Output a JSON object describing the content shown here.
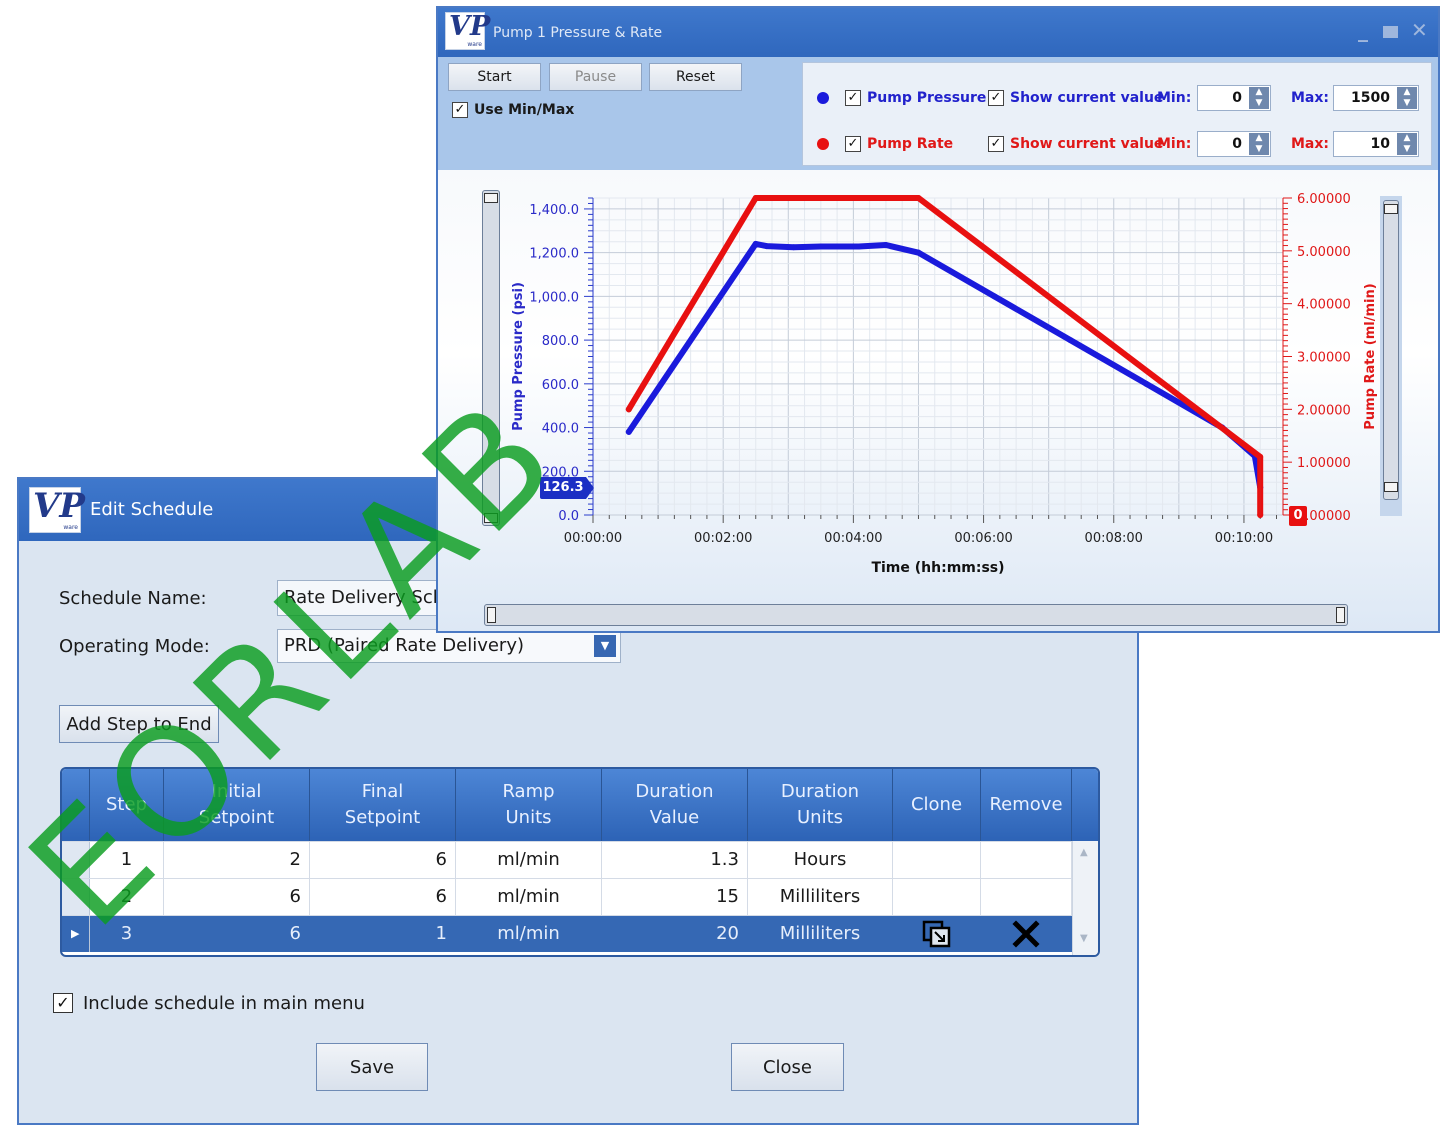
{
  "edit_schedule": {
    "title": "Edit Schedule",
    "logo_letters": "VP",
    "logo_sub": "ware",
    "schedule_name_label": "Schedule Name:",
    "schedule_name_value": "Rate Delivery Schedule",
    "operating_mode_label": "Operating Mode:",
    "operating_mode_value": "PRD (Paired Rate Delivery)",
    "add_step_label": "Add Step to End",
    "columns": [
      "Step",
      "Initial Setpoint",
      "Final Setpoint",
      "Ramp Units",
      "Duration Value",
      "Duration Units",
      "Clone",
      "Remove"
    ],
    "rows": [
      {
        "step": "1",
        "initial": "2",
        "final": "6",
        "ramp_units": "ml/min",
        "duration_value": "1.3",
        "duration_units": "Hours"
      },
      {
        "step": "2",
        "initial": "6",
        "final": "6",
        "ramp_units": "ml/min",
        "duration_value": "15",
        "duration_units": "Milliliters"
      },
      {
        "step": "3",
        "initial": "6",
        "final": "1",
        "ramp_units": "ml/min",
        "duration_value": "20",
        "duration_units": "Milliliters"
      }
    ],
    "selected_row": 3,
    "include_label": "Include schedule in main menu",
    "include_checked": true,
    "save_label": "Save",
    "close_label": "Close"
  },
  "pump_window": {
    "title": "Pump 1 Pressure & Rate",
    "logo_letters": "VP",
    "logo_sub": "ware",
    "start_label": "Start",
    "pause_label": "Pause",
    "reset_label": "Reset",
    "use_minmax_label": "Use Min/Max",
    "pressure_series_label": "Pump Pressure",
    "rate_series_label": "Pump Rate",
    "show_current_label": "Show current value",
    "min_label": "Min:",
    "max_label": "Max:",
    "pressure_min": "0",
    "pressure_max": "1500",
    "rate_min": "0",
    "rate_max": "10",
    "current_pressure": "126.3",
    "current_rate": "0",
    "colors": {
      "pressure": "#1a1adc",
      "rate": "#e81010"
    }
  },
  "watermark": "EORLAB",
  "chart_data": {
    "type": "line",
    "xlabel": "Time (hh:mm:ss)",
    "ylabel": "Pump Pressure (psi)",
    "y2label": "Pump Rate (ml/min)",
    "x_ticks": [
      "00:00:00",
      "00:02:00",
      "00:04:00",
      "00:06:00",
      "00:08:00",
      "00:10:00"
    ],
    "y_ticks": [
      "0.0",
      "200.0",
      "400.0",
      "600.0",
      "800.0",
      "1,000.0",
      "1,200.0",
      "1,400.0"
    ],
    "y2_ticks": [
      "0.00000",
      "1.00000",
      "2.00000",
      "3.00000",
      "4.00000",
      "5.00000",
      "6.00000"
    ],
    "xlim_seconds": [
      0,
      636
    ],
    "ylim": [
      0,
      1450
    ],
    "y2lim": [
      0,
      6.0
    ],
    "grid": true,
    "series": [
      {
        "name": "Pump Pressure",
        "axis": "left",
        "color": "#1a1adc",
        "x": [
          33,
          150,
          160,
          185,
          210,
          245,
          270,
          300,
          370,
          440,
          510,
          580,
          610,
          615
        ],
        "y": [
          380,
          1240,
          1230,
          1225,
          1228,
          1228,
          1235,
          1200,
          1000,
          800,
          600,
          400,
          270,
          126
        ]
      },
      {
        "name": "Pump Rate",
        "axis": "right",
        "color": "#e81010",
        "x": [
          33,
          150,
          300,
          615,
          615
        ],
        "y": [
          2.0,
          6.0,
          6.0,
          1.1,
          0
        ]
      }
    ]
  }
}
